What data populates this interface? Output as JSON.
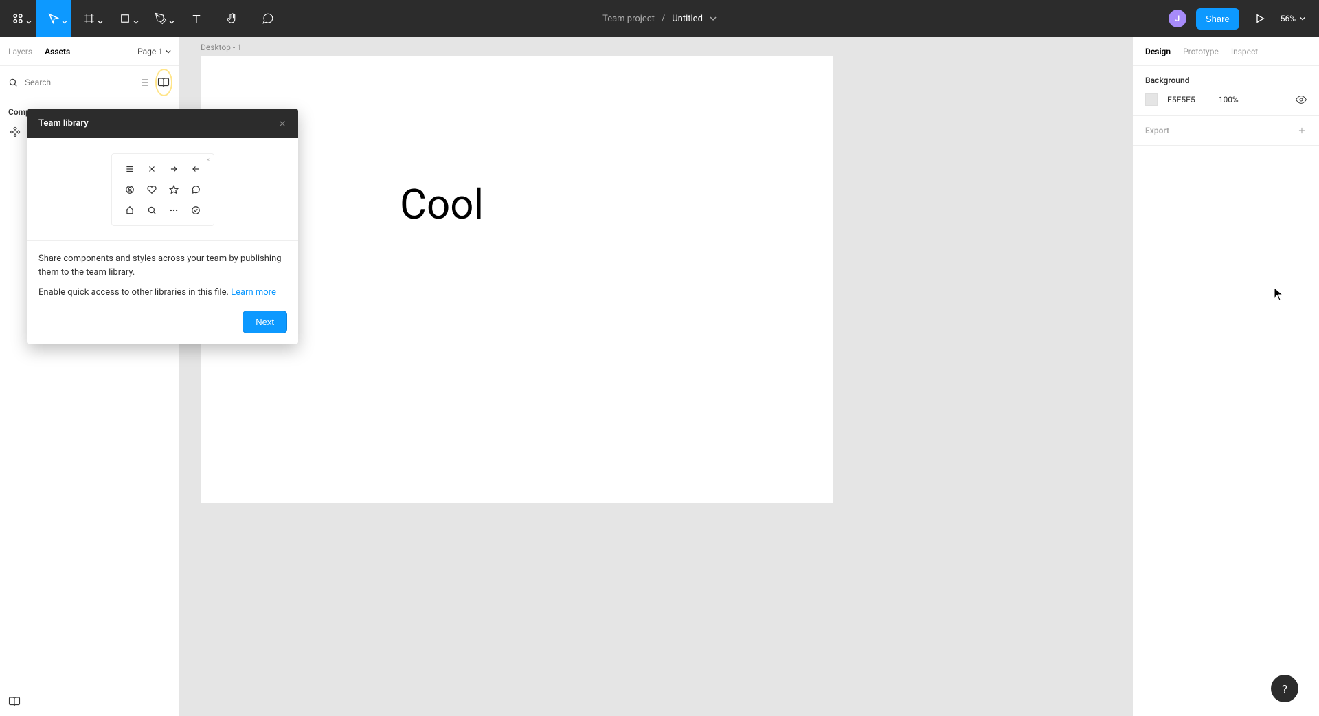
{
  "toolbar": {
    "project": "Team project",
    "filename": "Untitled",
    "share": "Share",
    "zoom": "56%",
    "avatar_initial": "J"
  },
  "left_panel": {
    "tabs": {
      "layers": "Layers",
      "assets": "Assets"
    },
    "page": "Page 1",
    "search_placeholder": "Search",
    "components_label": "Components"
  },
  "canvas": {
    "frame_label": "Desktop - 1",
    "text": "Cool"
  },
  "right_panel": {
    "tabs": {
      "design": "Design",
      "prototype": "Prototype",
      "inspect": "Inspect"
    },
    "background": {
      "title": "Background",
      "hex": "E5E5E5",
      "opacity": "100%"
    },
    "export": "Export"
  },
  "popover": {
    "title": "Team library",
    "body1": "Share components and styles across your team by publishing them to the team library.",
    "body2": "Enable quick access to other libraries in this file. ",
    "learn_more": "Learn more",
    "next": "Next"
  },
  "help": "?"
}
